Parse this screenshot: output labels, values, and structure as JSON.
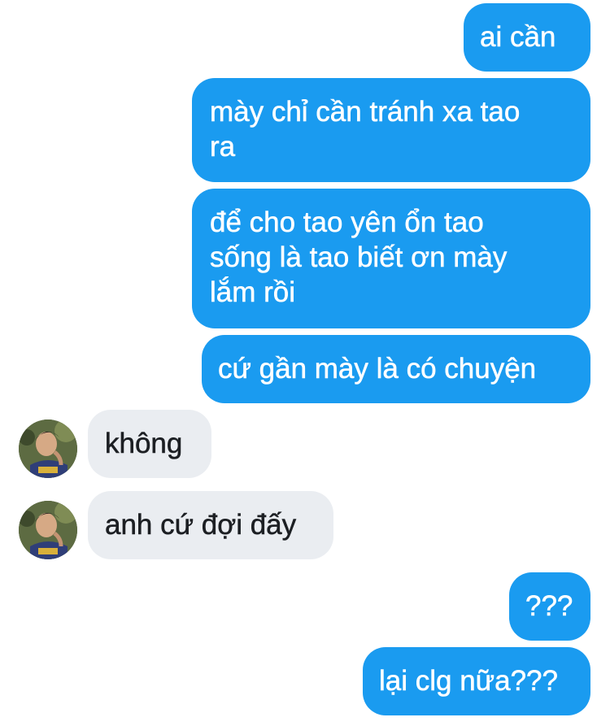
{
  "conversation": {
    "messages": [
      {
        "sender": "me",
        "lines": [
          "ai cần"
        ]
      },
      {
        "sender": "me",
        "lines": [
          "mày chỉ cần tránh xa tao",
          "ra"
        ]
      },
      {
        "sender": "me",
        "lines": [
          "để cho tao yên ổn tao",
          "sống là tao biết ơn mày",
          "lắm rồi"
        ]
      },
      {
        "sender": "me",
        "lines": [
          "cứ gần mày là có chuyện"
        ]
      },
      {
        "sender": "other",
        "lines": [
          "không"
        ]
      },
      {
        "sender": "other",
        "lines": [
          "anh cứ đợi đấy"
        ]
      },
      {
        "sender": "me",
        "lines": [
          "???"
        ]
      },
      {
        "sender": "me",
        "lines": [
          "lại clg nữa???"
        ]
      }
    ]
  },
  "colors": {
    "sent_bubble": "#1a9bf0",
    "received_bubble": "#eaedf1",
    "sent_text": "#ffffff",
    "received_text": "#1c1f23"
  },
  "icons": {
    "avatar": "contact-avatar-photo"
  }
}
